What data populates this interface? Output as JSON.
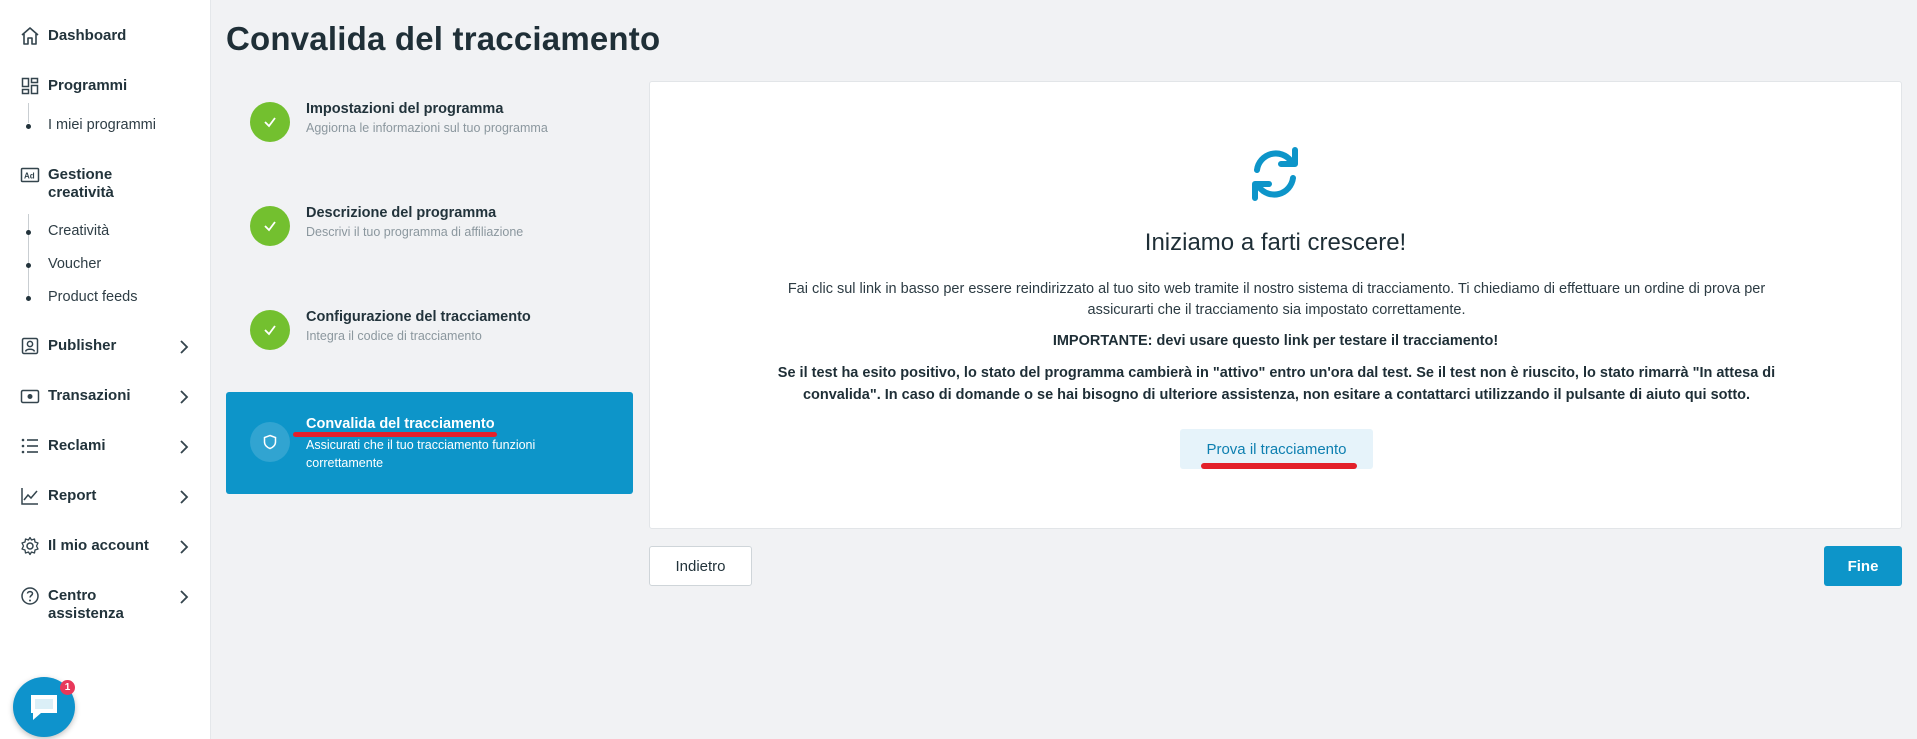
{
  "sidebar": {
    "items": [
      {
        "label": "Dashboard",
        "icon": "home-icon"
      },
      {
        "label": "Programmi",
        "icon": "grid-icon"
      },
      {
        "label": "Gestione creatività",
        "icon": "ad-icon"
      },
      {
        "label": "Publisher",
        "icon": "user-badge-icon"
      },
      {
        "label": "Transazioni",
        "icon": "wallet-icon"
      },
      {
        "label": "Reclami",
        "icon": "list-icon"
      },
      {
        "label": "Report",
        "icon": "chart-line-icon"
      },
      {
        "label": "Il mio account",
        "icon": "gear-icon"
      },
      {
        "label": "Centro assistenza",
        "icon": "help-icon"
      }
    ],
    "programmi_sub": [
      "I miei programmi"
    ],
    "creativita_sub": [
      "Creatività",
      "Voucher",
      "Product feeds"
    ],
    "chat_badge": "1"
  },
  "page": {
    "title": "Convalida del tracciamento"
  },
  "steps": [
    {
      "title": "Impostazioni del programma",
      "desc": "Aggiorna le informazioni sul tuo programma",
      "status": "done"
    },
    {
      "title": "Descrizione del programma",
      "desc": "Descrivi il tuo programma di affiliazione",
      "status": "done"
    },
    {
      "title": "Configurazione del tracciamento",
      "desc": "Integra il codice di tracciamento",
      "status": "done"
    },
    {
      "title": "Convalida del tracciamento",
      "desc": "Assicurati che il tuo tracciamento funzioni correttamente",
      "status": "active"
    }
  ],
  "card": {
    "heading": "Iniziamo a farti crescere!",
    "p1": "Fai clic sul link in basso per essere reindirizzato al tuo sito web tramite il nostro sistema di tracciamento. Ti chiediamo di effettuare un ordine di prova per assicurarti che il tracciamento sia impostato correttamente.",
    "p2": "IMPORTANTE: devi usare questo link per testare il tracciamento!",
    "p3": "Se il test ha esito positivo, lo stato del programma cambierà in \"attivo\" entro un'ora dal test. Se il test non è riuscito, lo stato rimarrà \"In attesa di convalida\". In caso di domande o se hai bisogno di ulteriore assistenza, non esitare a contattarci utilizzando il pulsante di aiuto qui sotto.",
    "try_button": "Prova il tracciamento"
  },
  "footer": {
    "back_label": "Indietro",
    "finish_label": "Fine"
  },
  "colors": {
    "accent": "#0d95c9",
    "success": "#73c02f",
    "annotation_red": "#e3202a"
  }
}
